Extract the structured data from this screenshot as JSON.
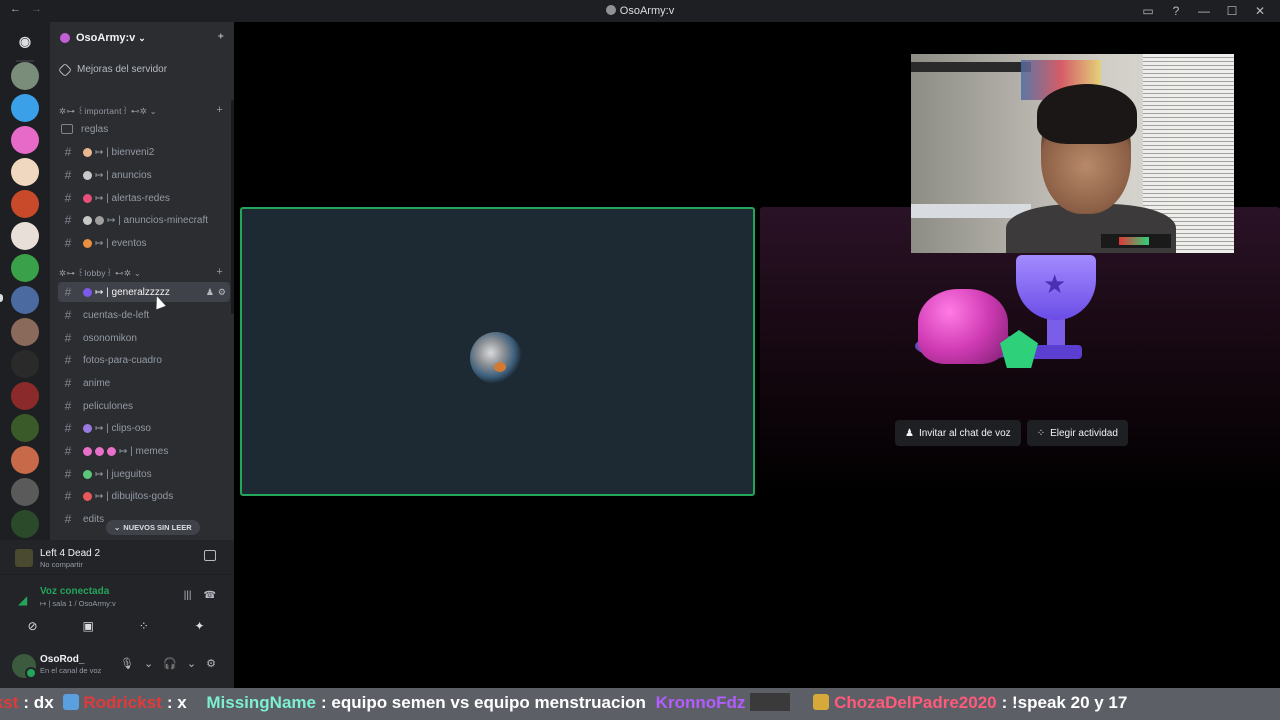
{
  "titlebar": {
    "title": "OsoArmy:v",
    "back_icon": "arrow-left-icon",
    "forward_icon": "arrow-right-icon",
    "inbox_icon": "inbox-icon",
    "help_icon": "help-icon",
    "minimize": "—",
    "maximize": "☐",
    "close": "✕"
  },
  "server": {
    "name": "OsoArmy:v",
    "boost_label": "Mejoras del servidor"
  },
  "categories": [
    {
      "label": "✲⊶ ꒰important꒱ ⊷✲ ⌄"
    },
    {
      "label": "✲⊶ ꒰lobby꒱ ⊷✲ ⌄"
    }
  ],
  "channels": [
    {
      "name": "reglas"
    },
    {
      "name": "↦ | bienveni2"
    },
    {
      "name": "↦ | anuncios"
    },
    {
      "name": "↦ | alertas-redes"
    },
    {
      "name": "↦ | anuncios-minecraft"
    },
    {
      "name": "↦ | eventos"
    },
    {
      "name": "↦ | generalzzzzz"
    },
    {
      "name": "cuentas-de-left"
    },
    {
      "name": "osonomikon"
    },
    {
      "name": "fotos-para-cuadro"
    },
    {
      "name": "anime"
    },
    {
      "name": "peliculones"
    },
    {
      "name": "↦ | clips-oso"
    },
    {
      "name": "↦ | memes"
    },
    {
      "name": "↦ | jueguitos"
    },
    {
      "name": "↦ | dibujitos-gods"
    },
    {
      "name": "edits"
    }
  ],
  "unread_pill": "NUEVOS SIN LEER",
  "activity_panel": {
    "game": "Left 4 Dead 2",
    "sub": "No compartir"
  },
  "voice": {
    "status": "Voz conectada",
    "channel": "↦ | sala 1 / OsoArmy:v"
  },
  "user": {
    "name": "OsoRod_",
    "status": "En el canal de voz"
  },
  "activity": {
    "invite_label": "Invitar al chat de voz",
    "choose_label": "Elegir actividad"
  },
  "ticker": [
    {
      "user": "Rodrickst",
      "text": ": dx"
    },
    {
      "user": "Rodrickst",
      "text": ": x"
    },
    {
      "user": "MissingName",
      "text": ": equipo semen vs equipo menstruacion"
    },
    {
      "user": "KronnoFdz",
      "text": ""
    },
    {
      "user": "ChozaDelPadre2020",
      "text": ": !speak 20 y 17"
    }
  ],
  "colors": {
    "accent_green": "#23a55a",
    "sidebar": "#2b2d31",
    "rail": "#1e1f22",
    "ticker_bg": "#5c5f66"
  }
}
